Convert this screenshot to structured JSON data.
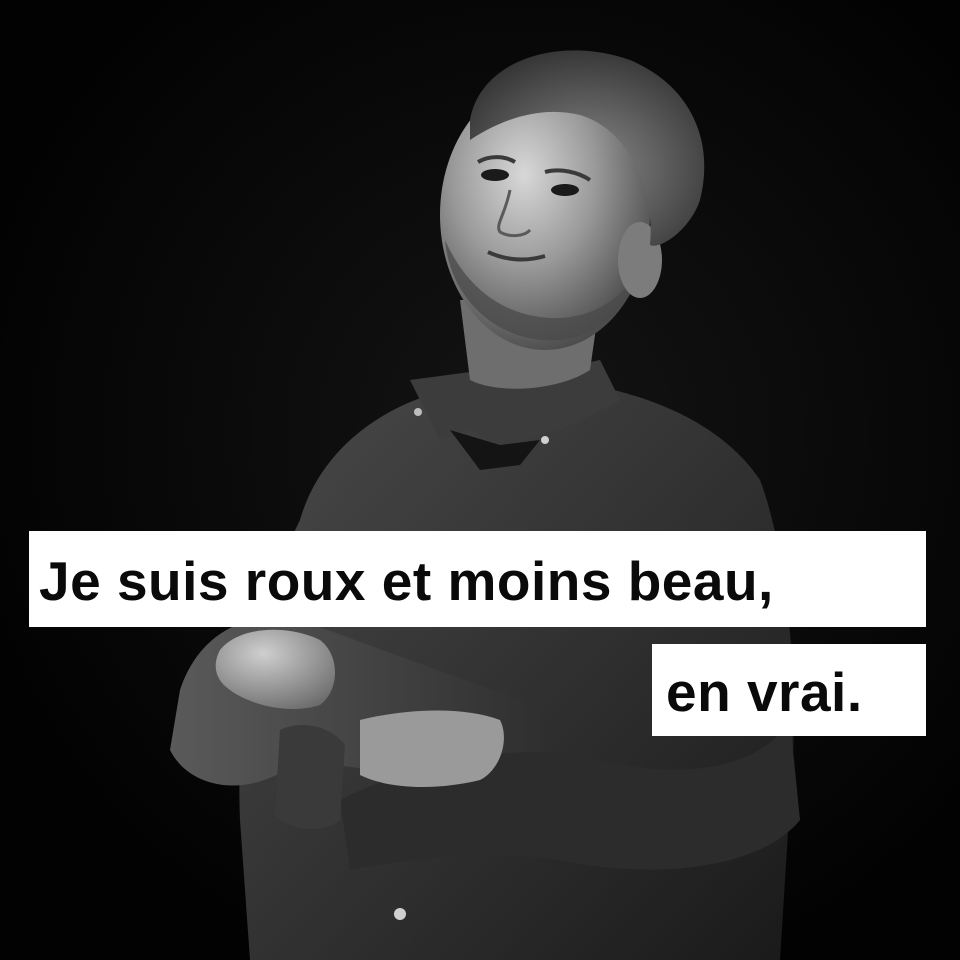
{
  "caption": {
    "line1": "Je suis roux et moins beau,",
    "line2": "en vrai."
  },
  "colors": {
    "background": "#030303",
    "caption_box": "#ffffff",
    "caption_text": "#0a0a0a"
  },
  "photo": {
    "style": "black-and-white"
  }
}
